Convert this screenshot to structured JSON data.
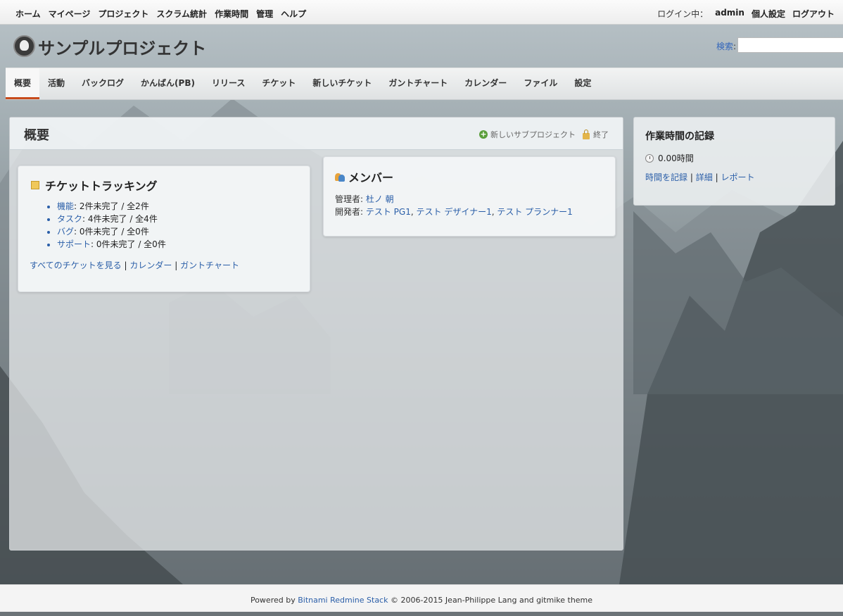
{
  "top_menu": {
    "items": [
      "ホーム",
      "マイページ",
      "プロジェクト",
      "スクラム統計",
      "作業時間",
      "管理",
      "ヘルプ"
    ],
    "login_label": "ログイン中：",
    "user": "admin",
    "my_account": "個人設定",
    "logout": "ログアウト"
  },
  "header": {
    "project_title": "サンプルプロジェクト",
    "search_label": "検索",
    "search_colon": ":",
    "search_value": ""
  },
  "main_menu": {
    "tabs": [
      "概要",
      "活動",
      "バックログ",
      "かんばん(PB)",
      "リリース",
      "チケット",
      "新しいチケット",
      "ガントチャート",
      "カレンダー",
      "ファイル",
      "設定"
    ],
    "selected": "概要"
  },
  "content": {
    "title": "概要",
    "new_subproject": "新しいサブプロジェクト",
    "close": "終了"
  },
  "issue_tracking": {
    "title": "チケットトラッキング",
    "trackers": [
      {
        "name": "機能",
        "status": ": 2件未完了 / 全2件"
      },
      {
        "name": "タスク",
        "status": ": 4件未完了 / 全4件"
      },
      {
        "name": "バグ",
        "status": ": 0件未完了 / 全0件"
      },
      {
        "name": "サポート",
        "status": ": 0件未完了 / 全0件"
      }
    ],
    "view_all": "すべてのチケットを見る",
    "calendar": "カレンダー",
    "gantt": "ガントチャート",
    "separator": "|"
  },
  "members": {
    "title": "メンバー",
    "manager_role": "管理者: ",
    "manager": "杜ノ 朝",
    "developer_role": "開発者: ",
    "developers": [
      "テスト PG1",
      "テスト デザイナー1",
      "テスト プランナー1"
    ],
    "comma": ", "
  },
  "sidebar": {
    "title": "作業時間の記録",
    "spent_time": "0.00時間",
    "log_time": "時間を記録",
    "details": "詳細",
    "report": "レポート",
    "separator": "|"
  },
  "footer": {
    "powered_by": "Powered by ",
    "link": "Bitnami Redmine Stack",
    "copyright": " © 2006-2015 Jean-Philippe Lang and gitmike theme"
  },
  "colors": {
    "link": "#2a5ea8",
    "selected_tab_underline": "#c84b1c"
  }
}
